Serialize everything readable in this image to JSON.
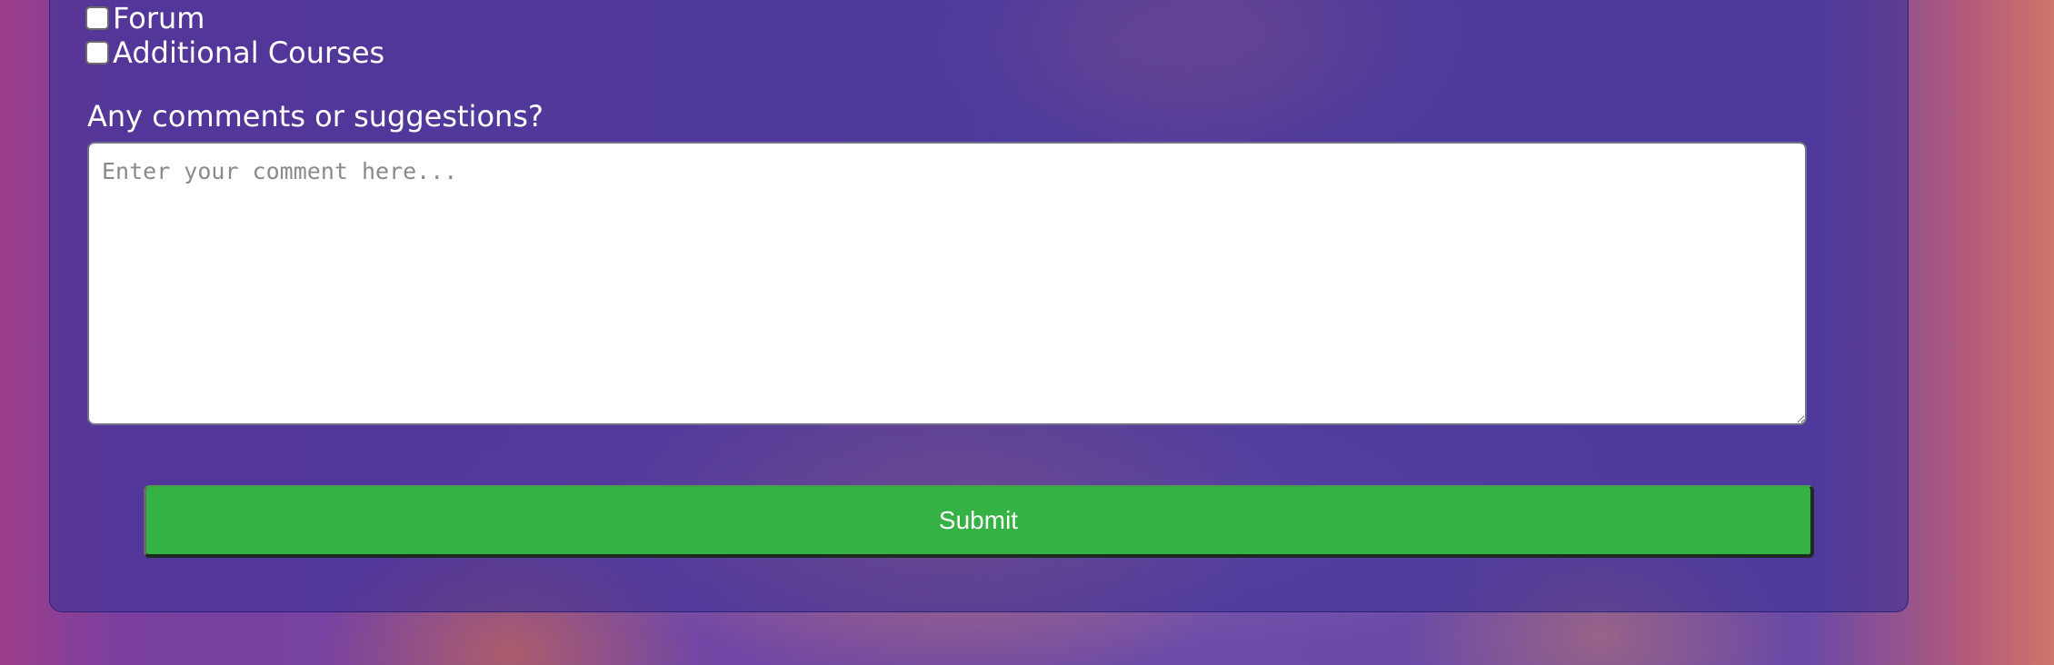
{
  "form": {
    "options": [
      {
        "label": "Forum",
        "checked": false
      },
      {
        "label": "Additional Courses",
        "checked": false
      }
    ],
    "comments": {
      "label": "Any comments or suggestions?",
      "placeholder": "Enter your comment here...",
      "value": ""
    },
    "submit_label": "Submit"
  },
  "colors": {
    "panel": "#3c3096",
    "submit_button": "#34b243",
    "label_text": "#ffffff"
  }
}
